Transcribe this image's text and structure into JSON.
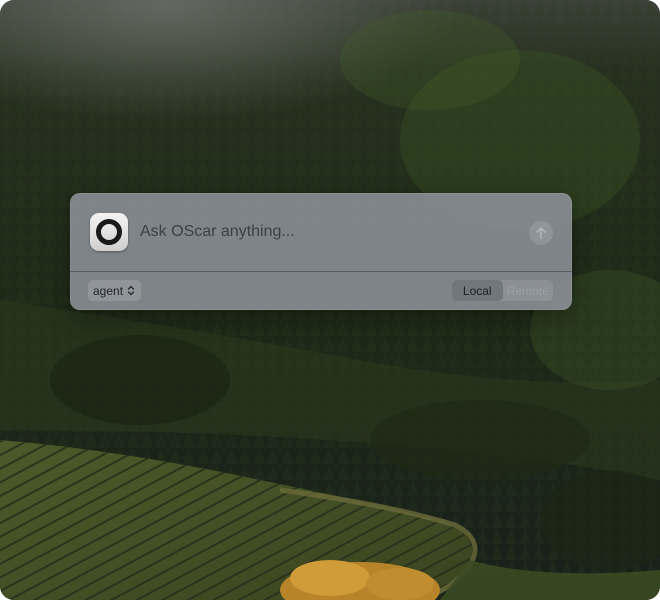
{
  "prompt": {
    "placeholder": "Ask OScar anything...",
    "value": ""
  },
  "app_icon": "oscar-ring-icon",
  "send_icon": "arrow-up-icon",
  "mode_select": {
    "selected": "agent",
    "icon": "chevron-updown-icon"
  },
  "location_toggle": {
    "options": [
      "Local",
      "Remote"
    ],
    "selected": "Local"
  },
  "colors": {
    "panel": "#8c9198",
    "selected_segment": "#696e75",
    "text_dark": "#1f2226",
    "text_muted": "#9ba0a6"
  }
}
